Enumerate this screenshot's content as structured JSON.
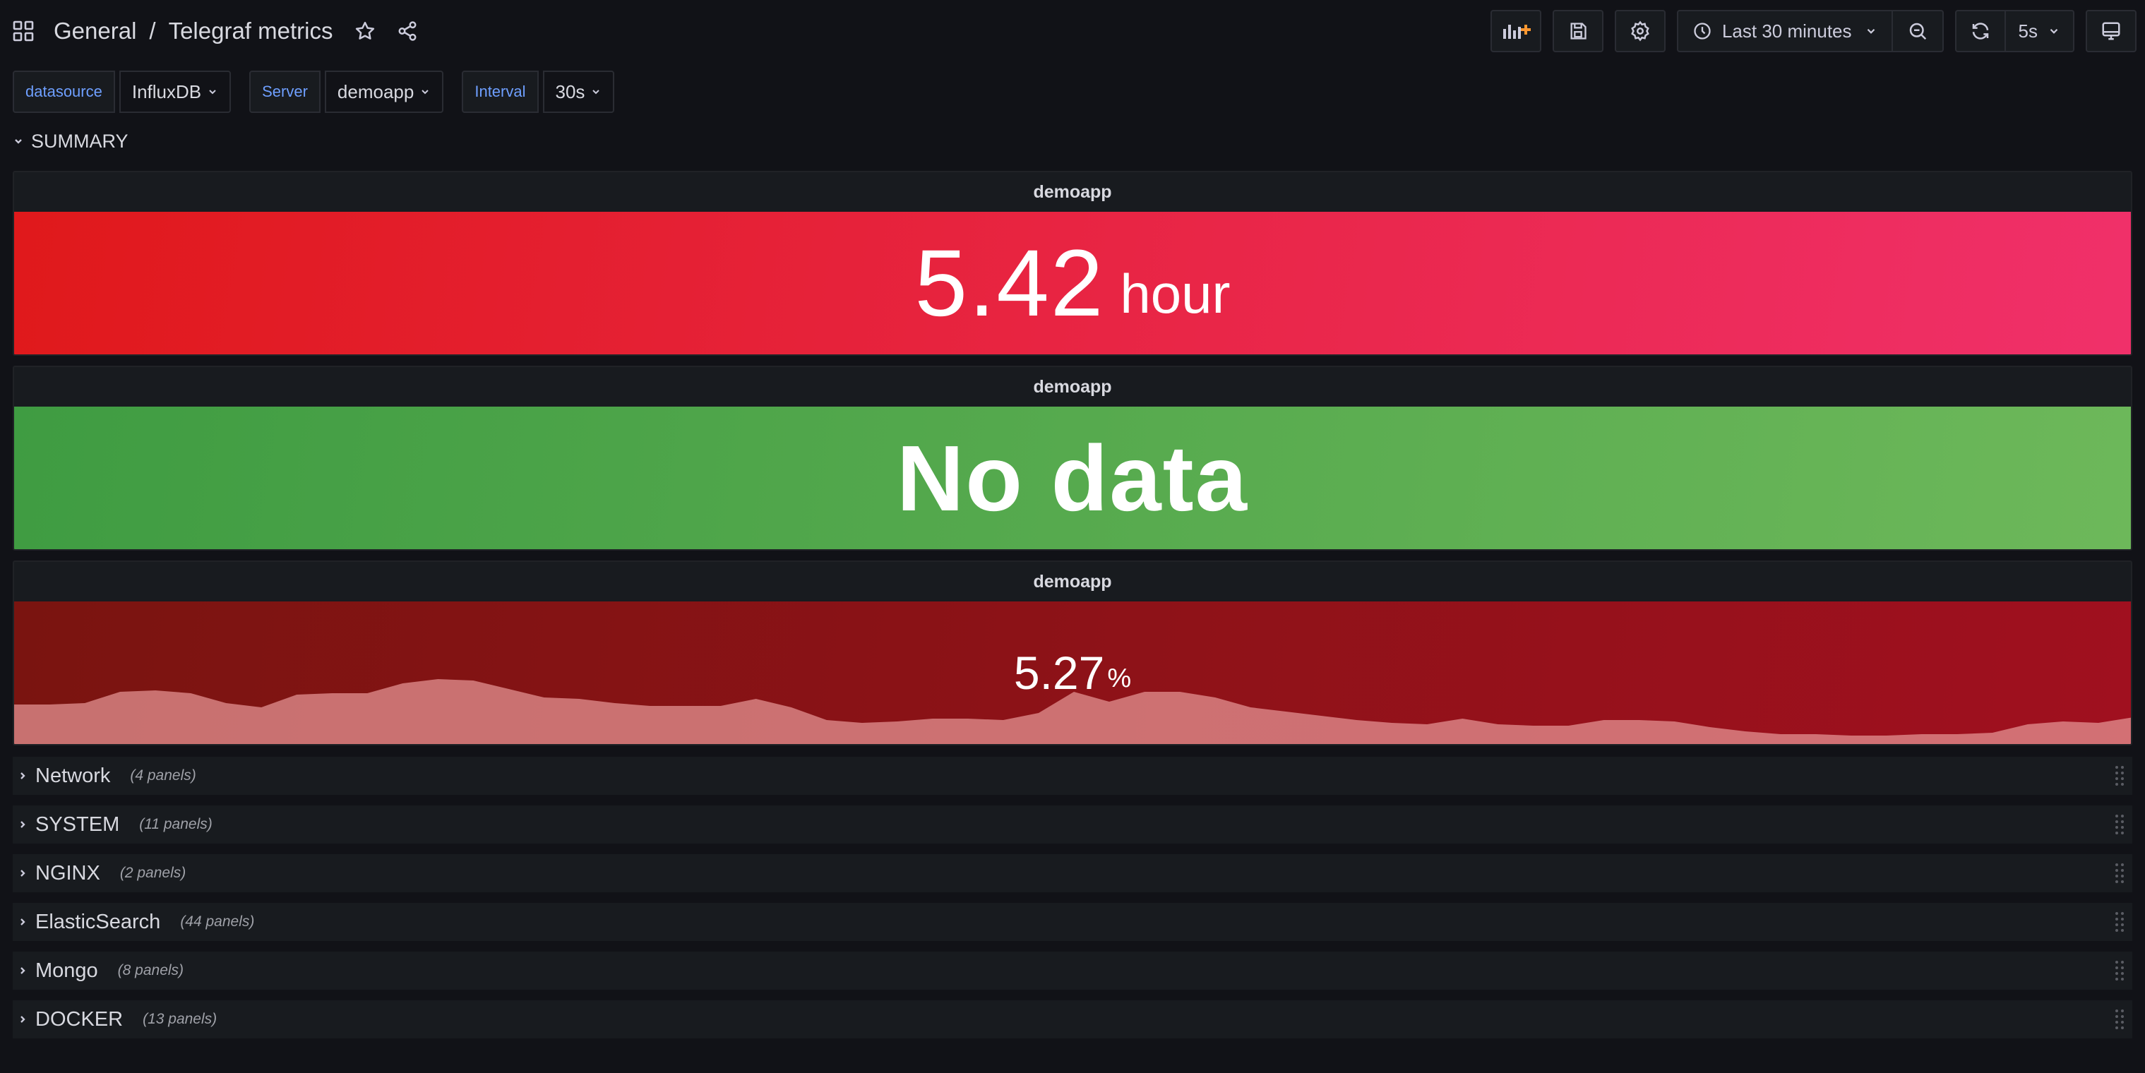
{
  "breadcrumb": {
    "folder": "General",
    "separator": "/",
    "dashboard": "Telegraf metrics"
  },
  "toolbar": {
    "time_range": "Last 30 minutes",
    "refresh_interval": "5s"
  },
  "variables": [
    {
      "label": "datasource",
      "value": "InfluxDB"
    },
    {
      "label": "Server",
      "value": "demoapp"
    },
    {
      "label": "Interval",
      "value": "30s"
    }
  ],
  "summary_row": {
    "title": "SUMMARY"
  },
  "panels": [
    {
      "title": "demoapp",
      "value": "5.42",
      "unit": "hour",
      "color": "#e8233f"
    },
    {
      "title": "demoapp",
      "value": "No data",
      "color": "#56a64b"
    },
    {
      "title": "demoapp",
      "value": "5.27",
      "unit": "%",
      "color": "#8f1218",
      "sparkline": [
        0.28,
        0.28,
        0.29,
        0.37,
        0.38,
        0.36,
        0.29,
        0.26,
        0.35,
        0.36,
        0.36,
        0.43,
        0.46,
        0.45,
        0.39,
        0.33,
        0.32,
        0.29,
        0.27,
        0.27,
        0.27,
        0.32,
        0.26,
        0.17,
        0.15,
        0.16,
        0.18,
        0.18,
        0.17,
        0.22,
        0.37,
        0.3,
        0.37,
        0.37,
        0.33,
        0.26,
        0.23,
        0.2,
        0.17,
        0.15,
        0.14,
        0.18,
        0.14,
        0.13,
        0.13,
        0.17,
        0.17,
        0.16,
        0.12,
        0.09,
        0.07,
        0.07,
        0.06,
        0.06,
        0.07,
        0.07,
        0.08,
        0.14,
        0.16,
        0.15,
        0.19
      ]
    }
  ],
  "collapsed_rows": [
    {
      "title": "Network",
      "count": "(4 panels)"
    },
    {
      "title": "SYSTEM",
      "count": "(11 panels)"
    },
    {
      "title": "NGINX",
      "count": "(2 panels)"
    },
    {
      "title": "ElasticSearch",
      "count": "(44 panels)"
    },
    {
      "title": "Mongo",
      "count": "(8 panels)"
    },
    {
      "title": "DOCKER",
      "count": "(13 panels)"
    }
  ]
}
